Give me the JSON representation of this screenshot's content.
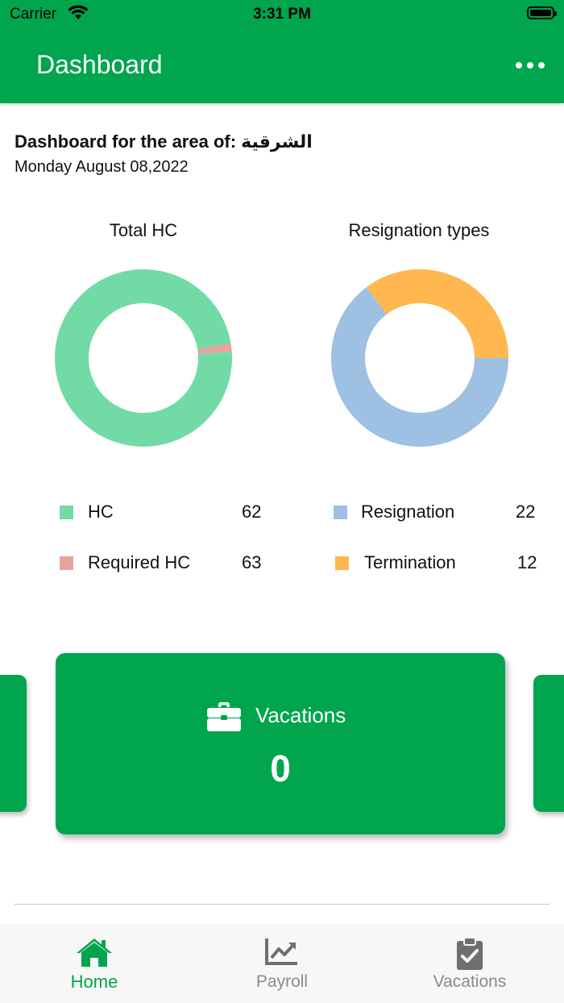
{
  "status_bar": {
    "carrier": "Carrier",
    "time": "3:31 PM"
  },
  "header": {
    "title": "Dashboard",
    "more_icon": "more-horizontal-icon"
  },
  "info": {
    "area_line": "Dashboard for the area of: الشرقية",
    "date": "Monday August 08,2022"
  },
  "colors": {
    "brand": "#00a54d",
    "hc": "#72dba5",
    "required_hc": "#e8a39c",
    "resignation": "#9dc0e3",
    "termination": "#ffb84f"
  },
  "chart_data": [
    {
      "type": "pie",
      "title": "Total HC",
      "donut": true,
      "series": [
        {
          "name": "HC",
          "value": 62,
          "color": "#72dba5"
        },
        {
          "name": "Required HC",
          "value": 63,
          "color": "#e8a39c"
        }
      ]
    },
    {
      "type": "pie",
      "title": "Resignation types",
      "donut": true,
      "series": [
        {
          "name": "Resignation",
          "value": 22,
          "color": "#9dc0e3"
        },
        {
          "name": "Termination",
          "value": 12,
          "color": "#ffb84f"
        }
      ]
    }
  ],
  "chart_slices": {
    "total_hc": [
      {
        "name": "HC",
        "fraction": 0.985,
        "color": "#72dba5"
      },
      {
        "name": "Required HC",
        "fraction": 0.015,
        "color": "#e8a39c"
      }
    ],
    "resignation_types": [
      {
        "name": "Resignation",
        "fraction": 0.647,
        "color": "#9dc0e3"
      },
      {
        "name": "Termination",
        "fraction": 0.353,
        "color": "#ffb84f"
      }
    ]
  },
  "carousel": {
    "card_label": "Vacations",
    "card_value": "0",
    "card_icon": "briefcase-icon"
  },
  "tabs": [
    {
      "label": "Home",
      "icon": "home-icon",
      "active": true
    },
    {
      "label": "Payroll",
      "icon": "chart-line-icon",
      "active": false
    },
    {
      "label": "Vacations",
      "icon": "clipboard-check-icon",
      "active": false
    }
  ]
}
